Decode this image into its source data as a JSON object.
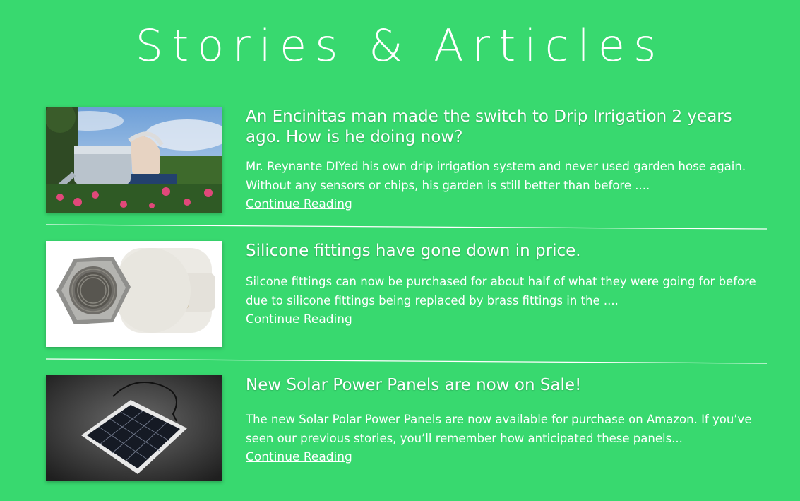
{
  "page": {
    "title": "Stories & Articles"
  },
  "articles": [
    {
      "title": "An Encinitas man made the switch to Drip Irrigation 2 years ago. How is he doing now?",
      "excerpt": "Mr. Reynante DIYed his own drip irrigation system and never used garden hose again. Without any sensors or chips, his garden is still better than before ....",
      "link": "Continue Reading",
      "image": "man-watering-garden-photo"
    },
    {
      "title": "Silicone fittings have gone down in price.",
      "excerpt": "Silcone fittings can now be purchased for about half of what they were going for before due to silicone fittings being replaced by brass fittings in the ....",
      "link": "Continue Reading",
      "image": "pipe-fitting-photo"
    },
    {
      "title": "New Solar Power Panels are now on Sale!",
      "excerpt": " The new Solar Polar Power Panels are now available for purchase on Amazon. If you’ve seen our previous stories, you’ll remember how anticipated these panels...",
      "link": "Continue Reading",
      "image": "solar-panel-photo"
    }
  ],
  "colors": {
    "background": "#38d96f",
    "text": "#ffffff"
  }
}
